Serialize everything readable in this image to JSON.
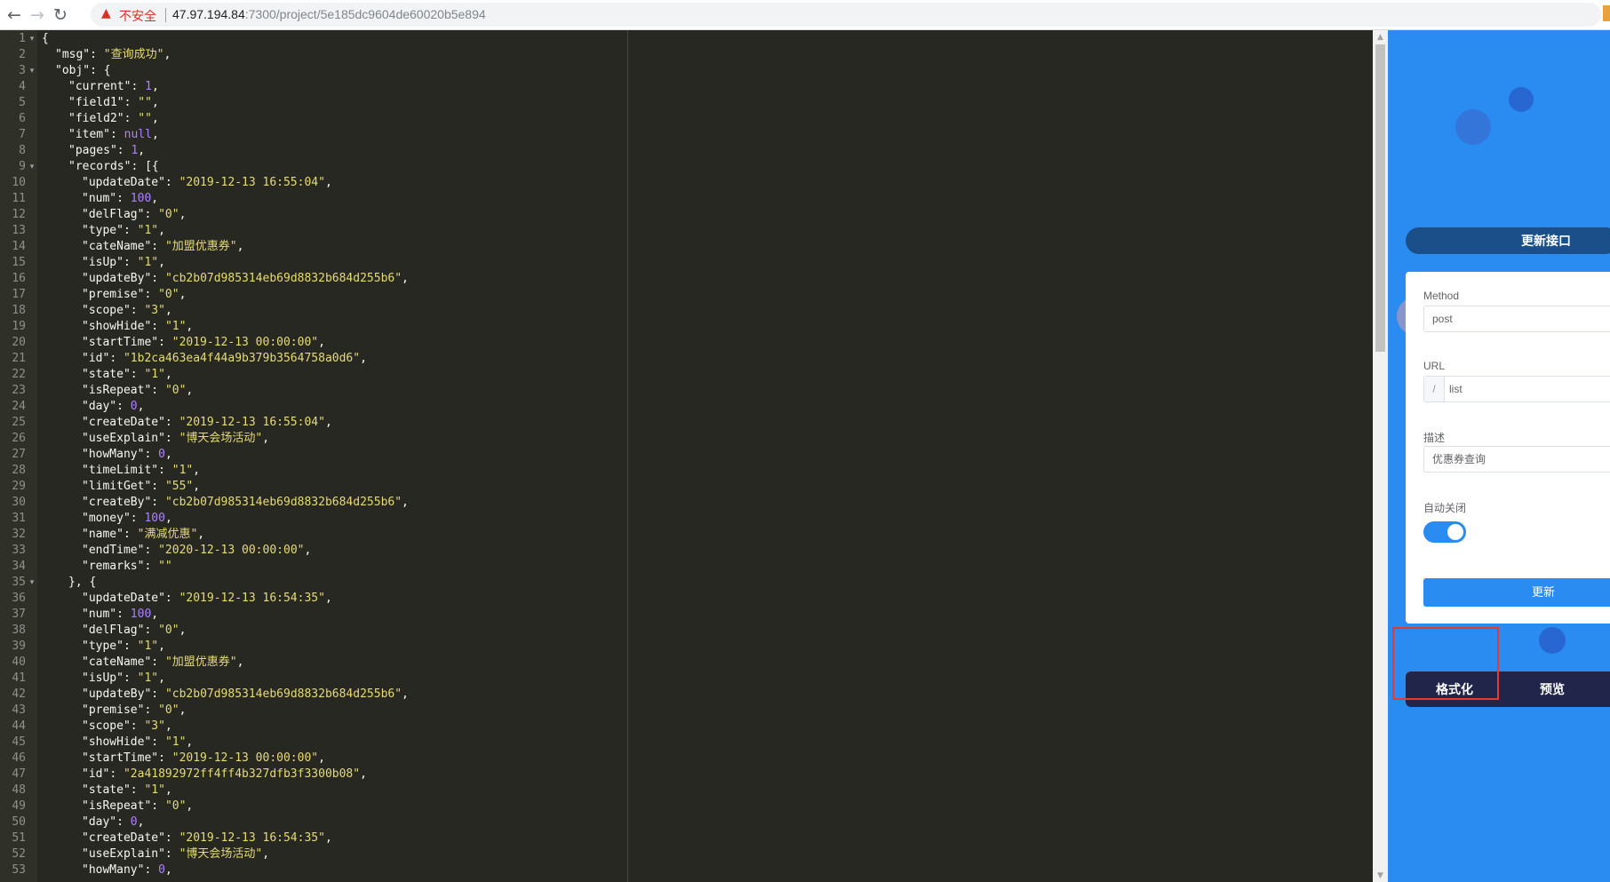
{
  "browser": {
    "insecure_label": "不安全",
    "url_host": "47.97.194.84",
    "url_path": ":7300/project/5e185dc9604de60020b5e894",
    "icons": {
      "back": "back-arrow-icon",
      "forward": "forward-arrow-icon",
      "reload": "reload-icon",
      "warning": "warning-icon",
      "bookmark": "star-icon"
    }
  },
  "editor": {
    "theme": {
      "background": "#272822",
      "gutter": "#2f3129",
      "string": "#e6db74",
      "number": "#ae81ff",
      "text": "#f8f8f2"
    },
    "lines": [
      {
        "n": "1",
        "fold": true,
        "indent": 0,
        "parts": [
          [
            "p",
            "{"
          ]
        ]
      },
      {
        "n": "2",
        "indent": 1,
        "parts": [
          [
            "k",
            "\"msg\""
          ],
          [
            "p",
            ": "
          ],
          [
            "s",
            "\"查询成功\""
          ],
          [
            "p",
            ","
          ]
        ]
      },
      {
        "n": "3",
        "fold": true,
        "indent": 1,
        "parts": [
          [
            "k",
            "\"obj\""
          ],
          [
            "p",
            ": {"
          ]
        ]
      },
      {
        "n": "4",
        "indent": 2,
        "parts": [
          [
            "k",
            "\"current\""
          ],
          [
            "p",
            ": "
          ],
          [
            "n",
            "1"
          ],
          [
            "p",
            ","
          ]
        ]
      },
      {
        "n": "5",
        "indent": 2,
        "parts": [
          [
            "k",
            "\"field1\""
          ],
          [
            "p",
            ": "
          ],
          [
            "s",
            "\"\""
          ],
          [
            "p",
            ","
          ]
        ]
      },
      {
        "n": "6",
        "indent": 2,
        "parts": [
          [
            "k",
            "\"field2\""
          ],
          [
            "p",
            ": "
          ],
          [
            "s",
            "\"\""
          ],
          [
            "p",
            ","
          ]
        ]
      },
      {
        "n": "7",
        "indent": 2,
        "parts": [
          [
            "k",
            "\"item\""
          ],
          [
            "p",
            ": "
          ],
          [
            "n",
            "null"
          ],
          [
            "p",
            ","
          ]
        ]
      },
      {
        "n": "8",
        "indent": 2,
        "parts": [
          [
            "k",
            "\"pages\""
          ],
          [
            "p",
            ": "
          ],
          [
            "n",
            "1"
          ],
          [
            "p",
            ","
          ]
        ]
      },
      {
        "n": "9",
        "fold": true,
        "indent": 2,
        "parts": [
          [
            "k",
            "\"records\""
          ],
          [
            "p",
            ": [{"
          ]
        ]
      },
      {
        "n": "10",
        "indent": 3,
        "parts": [
          [
            "k",
            "\"updateDate\""
          ],
          [
            "p",
            ": "
          ],
          [
            "s",
            "\"2019-12-13 16:55:04\""
          ],
          [
            "p",
            ","
          ]
        ]
      },
      {
        "n": "11",
        "indent": 3,
        "parts": [
          [
            "k",
            "\"num\""
          ],
          [
            "p",
            ": "
          ],
          [
            "n",
            "100"
          ],
          [
            "p",
            ","
          ]
        ]
      },
      {
        "n": "12",
        "indent": 3,
        "parts": [
          [
            "k",
            "\"delFlag\""
          ],
          [
            "p",
            ": "
          ],
          [
            "s",
            "\"0\""
          ],
          [
            "p",
            ","
          ]
        ]
      },
      {
        "n": "13",
        "indent": 3,
        "parts": [
          [
            "k",
            "\"type\""
          ],
          [
            "p",
            ": "
          ],
          [
            "s",
            "\"1\""
          ],
          [
            "p",
            ","
          ]
        ]
      },
      {
        "n": "14",
        "indent": 3,
        "parts": [
          [
            "k",
            "\"cateName\""
          ],
          [
            "p",
            ": "
          ],
          [
            "s",
            "\"加盟优惠券\""
          ],
          [
            "p",
            ","
          ]
        ]
      },
      {
        "n": "15",
        "indent": 3,
        "parts": [
          [
            "k",
            "\"isUp\""
          ],
          [
            "p",
            ": "
          ],
          [
            "s",
            "\"1\""
          ],
          [
            "p",
            ","
          ]
        ]
      },
      {
        "n": "16",
        "indent": 3,
        "parts": [
          [
            "k",
            "\"updateBy\""
          ],
          [
            "p",
            ": "
          ],
          [
            "s",
            "\"cb2b07d985314eb69d8832b684d255b6\""
          ],
          [
            "p",
            ","
          ]
        ]
      },
      {
        "n": "17",
        "indent": 3,
        "parts": [
          [
            "k",
            "\"premise\""
          ],
          [
            "p",
            ": "
          ],
          [
            "s",
            "\"0\""
          ],
          [
            "p",
            ","
          ]
        ]
      },
      {
        "n": "18",
        "indent": 3,
        "parts": [
          [
            "k",
            "\"scope\""
          ],
          [
            "p",
            ": "
          ],
          [
            "s",
            "\"3\""
          ],
          [
            "p",
            ","
          ]
        ]
      },
      {
        "n": "19",
        "indent": 3,
        "parts": [
          [
            "k",
            "\"showHide\""
          ],
          [
            "p",
            ": "
          ],
          [
            "s",
            "\"1\""
          ],
          [
            "p",
            ","
          ]
        ]
      },
      {
        "n": "20",
        "indent": 3,
        "parts": [
          [
            "k",
            "\"startTime\""
          ],
          [
            "p",
            ": "
          ],
          [
            "s",
            "\"2019-12-13 00:00:00\""
          ],
          [
            "p",
            ","
          ]
        ]
      },
      {
        "n": "21",
        "indent": 3,
        "parts": [
          [
            "k",
            "\"id\""
          ],
          [
            "p",
            ": "
          ],
          [
            "s",
            "\"1b2ca463ea4f44a9b379b3564758a0d6\""
          ],
          [
            "p",
            ","
          ]
        ]
      },
      {
        "n": "22",
        "indent": 3,
        "parts": [
          [
            "k",
            "\"state\""
          ],
          [
            "p",
            ": "
          ],
          [
            "s",
            "\"1\""
          ],
          [
            "p",
            ","
          ]
        ]
      },
      {
        "n": "23",
        "indent": 3,
        "parts": [
          [
            "k",
            "\"isRepeat\""
          ],
          [
            "p",
            ": "
          ],
          [
            "s",
            "\"0\""
          ],
          [
            "p",
            ","
          ]
        ]
      },
      {
        "n": "24",
        "indent": 3,
        "parts": [
          [
            "k",
            "\"day\""
          ],
          [
            "p",
            ": "
          ],
          [
            "n",
            "0"
          ],
          [
            "p",
            ","
          ]
        ]
      },
      {
        "n": "25",
        "indent": 3,
        "parts": [
          [
            "k",
            "\"createDate\""
          ],
          [
            "p",
            ": "
          ],
          [
            "s",
            "\"2019-12-13 16:55:04\""
          ],
          [
            "p",
            ","
          ]
        ]
      },
      {
        "n": "26",
        "indent": 3,
        "parts": [
          [
            "k",
            "\"useExplain\""
          ],
          [
            "p",
            ": "
          ],
          [
            "s",
            "\"博天会场活动\""
          ],
          [
            "p",
            ","
          ]
        ]
      },
      {
        "n": "27",
        "indent": 3,
        "parts": [
          [
            "k",
            "\"howMany\""
          ],
          [
            "p",
            ": "
          ],
          [
            "n",
            "0"
          ],
          [
            "p",
            ","
          ]
        ]
      },
      {
        "n": "28",
        "indent": 3,
        "parts": [
          [
            "k",
            "\"timeLimit\""
          ],
          [
            "p",
            ": "
          ],
          [
            "s",
            "\"1\""
          ],
          [
            "p",
            ","
          ]
        ]
      },
      {
        "n": "29",
        "indent": 3,
        "parts": [
          [
            "k",
            "\"limitGet\""
          ],
          [
            "p",
            ": "
          ],
          [
            "s",
            "\"55\""
          ],
          [
            "p",
            ","
          ]
        ]
      },
      {
        "n": "30",
        "indent": 3,
        "parts": [
          [
            "k",
            "\"createBy\""
          ],
          [
            "p",
            ": "
          ],
          [
            "s",
            "\"cb2b07d985314eb69d8832b684d255b6\""
          ],
          [
            "p",
            ","
          ]
        ]
      },
      {
        "n": "31",
        "indent": 3,
        "parts": [
          [
            "k",
            "\"money\""
          ],
          [
            "p",
            ": "
          ],
          [
            "n",
            "100"
          ],
          [
            "p",
            ","
          ]
        ]
      },
      {
        "n": "32",
        "indent": 3,
        "parts": [
          [
            "k",
            "\"name\""
          ],
          [
            "p",
            ": "
          ],
          [
            "s",
            "\"满减优惠\""
          ],
          [
            "p",
            ","
          ]
        ]
      },
      {
        "n": "33",
        "indent": 3,
        "parts": [
          [
            "k",
            "\"endTime\""
          ],
          [
            "p",
            ": "
          ],
          [
            "s",
            "\"2020-12-13 00:00:00\""
          ],
          [
            "p",
            ","
          ]
        ]
      },
      {
        "n": "34",
        "indent": 3,
        "parts": [
          [
            "k",
            "\"remarks\""
          ],
          [
            "p",
            ": "
          ],
          [
            "s",
            "\"\""
          ]
        ]
      },
      {
        "n": "35",
        "fold": true,
        "indent": 2,
        "parts": [
          [
            "p",
            "}, {"
          ]
        ]
      },
      {
        "n": "36",
        "indent": 3,
        "parts": [
          [
            "k",
            "\"updateDate\""
          ],
          [
            "p",
            ": "
          ],
          [
            "s",
            "\"2019-12-13 16:54:35\""
          ],
          [
            "p",
            ","
          ]
        ]
      },
      {
        "n": "37",
        "indent": 3,
        "parts": [
          [
            "k",
            "\"num\""
          ],
          [
            "p",
            ": "
          ],
          [
            "n",
            "100"
          ],
          [
            "p",
            ","
          ]
        ]
      },
      {
        "n": "38",
        "indent": 3,
        "parts": [
          [
            "k",
            "\"delFlag\""
          ],
          [
            "p",
            ": "
          ],
          [
            "s",
            "\"0\""
          ],
          [
            "p",
            ","
          ]
        ]
      },
      {
        "n": "39",
        "indent": 3,
        "parts": [
          [
            "k",
            "\"type\""
          ],
          [
            "p",
            ": "
          ],
          [
            "s",
            "\"1\""
          ],
          [
            "p",
            ","
          ]
        ]
      },
      {
        "n": "40",
        "indent": 3,
        "parts": [
          [
            "k",
            "\"cateName\""
          ],
          [
            "p",
            ": "
          ],
          [
            "s",
            "\"加盟优惠券\""
          ],
          [
            "p",
            ","
          ]
        ]
      },
      {
        "n": "41",
        "indent": 3,
        "parts": [
          [
            "k",
            "\"isUp\""
          ],
          [
            "p",
            ": "
          ],
          [
            "s",
            "\"1\""
          ],
          [
            "p",
            ","
          ]
        ]
      },
      {
        "n": "42",
        "indent": 3,
        "parts": [
          [
            "k",
            "\"updateBy\""
          ],
          [
            "p",
            ": "
          ],
          [
            "s",
            "\"cb2b07d985314eb69d8832b684d255b6\""
          ],
          [
            "p",
            ","
          ]
        ]
      },
      {
        "n": "43",
        "indent": 3,
        "parts": [
          [
            "k",
            "\"premise\""
          ],
          [
            "p",
            ": "
          ],
          [
            "s",
            "\"0\""
          ],
          [
            "p",
            ","
          ]
        ]
      },
      {
        "n": "44",
        "indent": 3,
        "parts": [
          [
            "k",
            "\"scope\""
          ],
          [
            "p",
            ": "
          ],
          [
            "s",
            "\"3\""
          ],
          [
            "p",
            ","
          ]
        ]
      },
      {
        "n": "45",
        "indent": 3,
        "parts": [
          [
            "k",
            "\"showHide\""
          ],
          [
            "p",
            ": "
          ],
          [
            "s",
            "\"1\""
          ],
          [
            "p",
            ","
          ]
        ]
      },
      {
        "n": "46",
        "indent": 3,
        "parts": [
          [
            "k",
            "\"startTime\""
          ],
          [
            "p",
            ": "
          ],
          [
            "s",
            "\"2019-12-13 00:00:00\""
          ],
          [
            "p",
            ","
          ]
        ]
      },
      {
        "n": "47",
        "indent": 3,
        "parts": [
          [
            "k",
            "\"id\""
          ],
          [
            "p",
            ": "
          ],
          [
            "s",
            "\"2a41892972ff4ff4b327dfb3f3300b08\""
          ],
          [
            "p",
            ","
          ]
        ]
      },
      {
        "n": "48",
        "indent": 3,
        "parts": [
          [
            "k",
            "\"state\""
          ],
          [
            "p",
            ": "
          ],
          [
            "s",
            "\"1\""
          ],
          [
            "p",
            ","
          ]
        ]
      },
      {
        "n": "49",
        "indent": 3,
        "parts": [
          [
            "k",
            "\"isRepeat\""
          ],
          [
            "p",
            ": "
          ],
          [
            "s",
            "\"0\""
          ],
          [
            "p",
            ","
          ]
        ]
      },
      {
        "n": "50",
        "indent": 3,
        "parts": [
          [
            "k",
            "\"day\""
          ],
          [
            "p",
            ": "
          ],
          [
            "n",
            "0"
          ],
          [
            "p",
            ","
          ]
        ]
      },
      {
        "n": "51",
        "indent": 3,
        "parts": [
          [
            "k",
            "\"createDate\""
          ],
          [
            "p",
            ": "
          ],
          [
            "s",
            "\"2019-12-13 16:54:35\""
          ],
          [
            "p",
            ","
          ]
        ]
      },
      {
        "n": "52",
        "indent": 3,
        "parts": [
          [
            "k",
            "\"useExplain\""
          ],
          [
            "p",
            ": "
          ],
          [
            "s",
            "\"博天会场活动\""
          ],
          [
            "p",
            ","
          ]
        ]
      },
      {
        "n": "53",
        "indent": 3,
        "parts": [
          [
            "k",
            "\"howMany\""
          ],
          [
            "p",
            ": "
          ],
          [
            "n",
            "0"
          ],
          [
            "p",
            ","
          ]
        ]
      }
    ]
  },
  "panel": {
    "title": "更新接口",
    "method_label": "Method",
    "method_value": "post",
    "url_label": "URL",
    "url_prefix": "/",
    "url_value": "list",
    "desc_label": "描述",
    "desc_value": "优惠券查询",
    "auto_close_label": "自动关闭",
    "auto_close_on": true,
    "update_button": "更新",
    "format_button": "格式化",
    "preview_button": "预览",
    "accent_color": "#2a8bf0",
    "highlight_color": "#e53935"
  }
}
